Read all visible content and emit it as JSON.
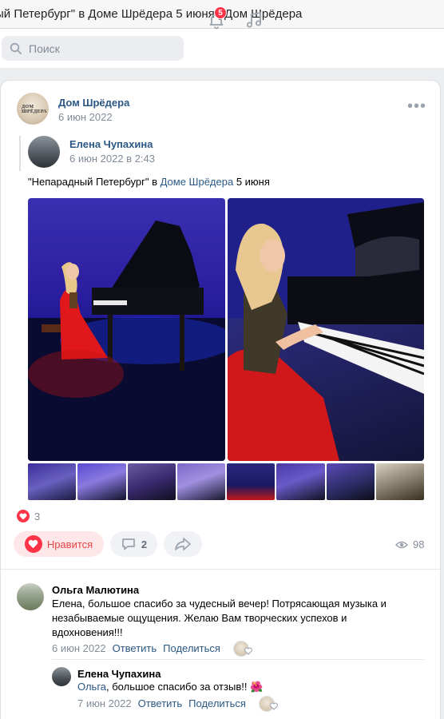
{
  "window": {
    "title": "ый Петербург\" в Доме Шрёдера 5 июня | Дом Шрёдера"
  },
  "topbar": {
    "search_placeholder": "Поиск",
    "notifications_count": "5"
  },
  "post": {
    "author": "Дом Шрёдера",
    "date": "6 июн 2022",
    "avatar_text": "ДОМ ШРЁДЕРА",
    "repost": {
      "author": "Елена Чупахина",
      "date": "6 июн 2022 в 2:43",
      "text_before": "\"Непарадный Петербург\" в ",
      "text_link": "Доме Шрёдера",
      "text_after": " 5 июня"
    },
    "likes_count": "3",
    "like_label": "Нравится",
    "comments_count": "2",
    "views_count": "98"
  },
  "comments": [
    {
      "author": "Ольга Малютина",
      "text": "Елена, большое спасибо за чудесный вечер! Потрясающая музыка и незабываемые ощущения. Желаю Вам творческих успехов и вдохновения!!!",
      "date": "6 июн 2022",
      "reply_label": "Ответить",
      "share_label": "Поделиться"
    },
    {
      "author": "Елена Чупахина",
      "mention": "Ольга",
      "text": ", большое спасибо за отзыв!! ",
      "emoji": "🌺",
      "date": "7 июн 2022",
      "reply_label": "Ответить",
      "share_label": "Поделиться"
    }
  ],
  "colors": {
    "accent": "#2a5885",
    "like_red": "#ff3347",
    "muted": "#818c99"
  }
}
